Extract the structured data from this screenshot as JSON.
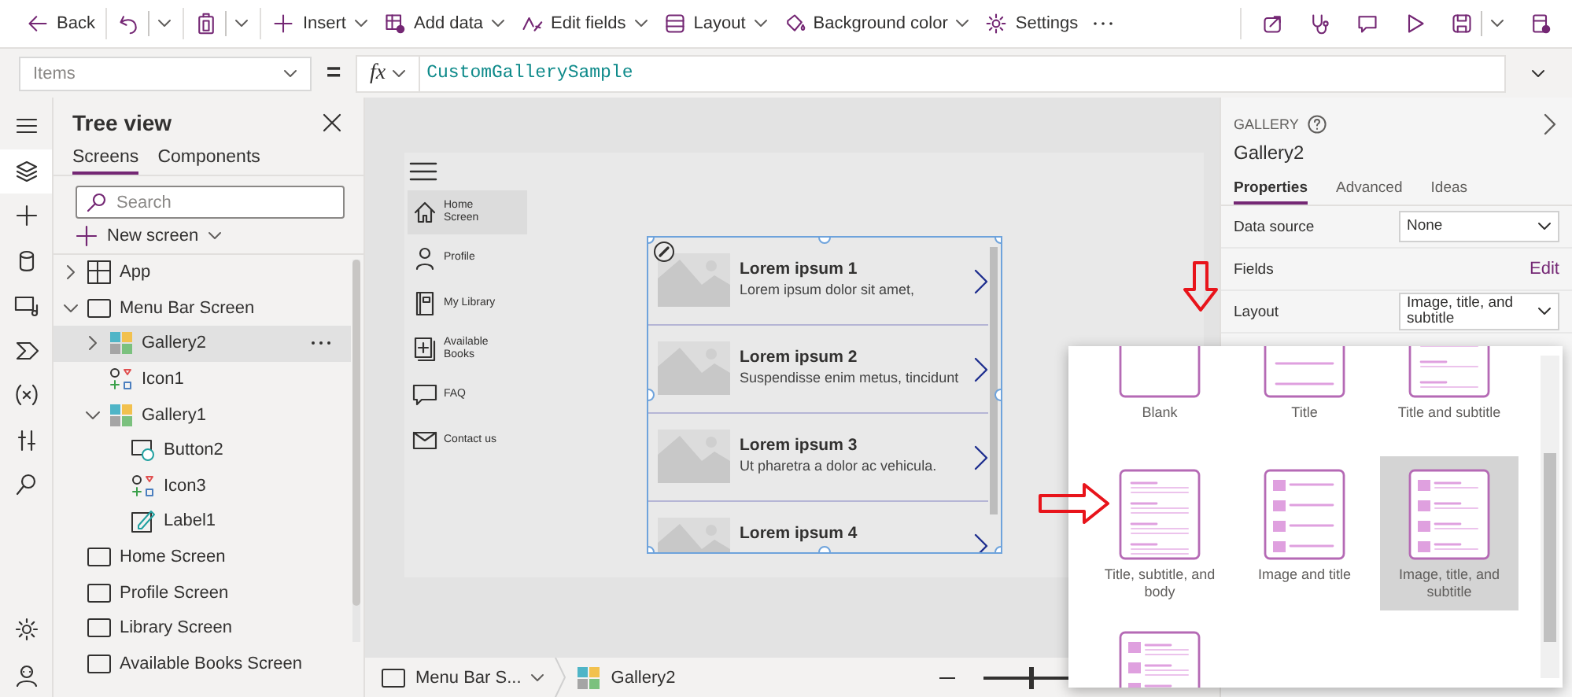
{
  "toolbar": {
    "items": [
      {
        "kind": "back",
        "label": "Back",
        "dropdown": false
      },
      {
        "kind": "undo",
        "dropdown": true
      },
      {
        "kind": "paste",
        "dropdown": true
      },
      {
        "kind": "insert",
        "label": "Insert",
        "dropdown": true
      },
      {
        "kind": "add-data",
        "label": "Add data",
        "dropdown": true
      },
      {
        "kind": "edit-fields",
        "label": "Edit fields",
        "dropdown": true
      },
      {
        "kind": "layout",
        "label": "Layout",
        "dropdown": true
      },
      {
        "kind": "background",
        "label": "Background color",
        "dropdown": true
      },
      {
        "kind": "settings",
        "label": "Settings",
        "dropdown": false
      },
      {
        "kind": "more",
        "dropdown": false
      }
    ],
    "actions": [
      {
        "kind": "share",
        "dropdown": false
      },
      {
        "kind": "checker",
        "dropdown": false
      },
      {
        "kind": "comment",
        "dropdown": false
      },
      {
        "kind": "play",
        "dropdown": false
      },
      {
        "kind": "save",
        "dropdown": true
      },
      {
        "kind": "publish",
        "dropdown": false
      }
    ]
  },
  "formula_bar": {
    "property": "Items",
    "operator": "=",
    "fx": "fx",
    "formula": "CustomGallerySample"
  },
  "left_rail": {
    "items": [
      {
        "kind": "menu",
        "selected": false
      },
      {
        "kind": "tree",
        "selected": true
      },
      {
        "kind": "insert",
        "selected": false
      },
      {
        "kind": "data",
        "selected": false
      },
      {
        "kind": "media",
        "selected": false
      },
      {
        "kind": "flow",
        "selected": false
      },
      {
        "kind": "variables",
        "selected": false
      },
      {
        "kind": "tools",
        "selected": false
      },
      {
        "kind": "search",
        "selected": false
      }
    ],
    "bottom_items": [
      {
        "kind": "settings",
        "selected": false
      },
      {
        "kind": "agent",
        "selected": false
      }
    ]
  },
  "tree_view": {
    "title": "Tree view",
    "tabs": [
      {
        "label": "Screens",
        "selected": true
      },
      {
        "label": "Components",
        "selected": false
      }
    ],
    "search": {
      "placeholder": "Search"
    },
    "new_screen": "New screen",
    "items": [
      {
        "kind": "app",
        "label": "App",
        "expanded": false,
        "selected": false
      },
      {
        "kind": "screen",
        "label": "Menu Bar Screen",
        "expanded": true,
        "selected": false,
        "children": [
          {
            "kind": "gallery",
            "label": "Gallery2",
            "expanded": false,
            "selected": true
          },
          {
            "kind": "icon",
            "label": "Icon1",
            "selected": false
          },
          {
            "kind": "gallery",
            "label": "Gallery1",
            "expanded": true,
            "selected": false,
            "children": [
              {
                "kind": "button",
                "label": "Button2",
                "selected": false
              },
              {
                "kind": "icon",
                "label": "Icon3",
                "selected": false
              },
              {
                "kind": "label",
                "label": "Label1",
                "selected": false
              }
            ]
          }
        ]
      },
      {
        "kind": "screen",
        "label": "Home Screen",
        "selected": false
      },
      {
        "kind": "screen",
        "label": "Profile Screen",
        "selected": false
      },
      {
        "kind": "screen",
        "label": "Library Screen",
        "selected": false
      },
      {
        "kind": "screen",
        "label": "Available Books Screen",
        "selected": false
      }
    ]
  },
  "canvas": {
    "app_screen": {
      "nav_items": [
        {
          "kind": "home",
          "label": "Home Screen",
          "selected": true
        },
        {
          "kind": "person",
          "label": "Profile",
          "selected": false
        },
        {
          "kind": "book",
          "label": "My Library",
          "selected": false
        },
        {
          "kind": "add-book",
          "label": "Available Books",
          "selected": false
        },
        {
          "kind": "chat",
          "label": "FAQ",
          "selected": false
        },
        {
          "kind": "mail",
          "label": "Contact us",
          "selected": false
        }
      ],
      "gallery": {
        "items": [
          {
            "title": "Lorem ipsum 1",
            "subtitle": "Lorem ipsum dolor sit amet,"
          },
          {
            "title": "Lorem ipsum 2",
            "subtitle": "Suspendisse enim metus, tincidunt"
          },
          {
            "title": "Lorem ipsum 3",
            "subtitle": "Ut pharetra a dolor ac vehicula."
          },
          {
            "title": "Lorem ipsum 4"
          }
        ]
      }
    },
    "bottom_bar": {
      "breadcrumbs": [
        {
          "kind": "screen",
          "label": "Menu Bar S...",
          "dropdown": true
        },
        {
          "kind": "gallery",
          "label": "Gallery2",
          "dropdown": false
        }
      ],
      "zoom": {
        "level": 0.2
      }
    }
  },
  "properties_panel": {
    "type": "GALLERY",
    "name": "Gallery2",
    "tabs": [
      {
        "label": "Properties",
        "selected": true
      },
      {
        "label": "Advanced",
        "selected": false
      },
      {
        "label": "Ideas",
        "selected": false
      }
    ],
    "rows": [
      {
        "kind": "dropdown",
        "label": "Data source",
        "value": "None"
      },
      {
        "kind": "link",
        "label": "Fields",
        "value": "Edit"
      },
      {
        "kind": "dropdown",
        "label": "Layout",
        "value": "Image, title, and subtitle"
      }
    ]
  },
  "layout_picker": {
    "options": [
      {
        "kind": "blank",
        "label": "Blank",
        "selected": false
      },
      {
        "kind": "title",
        "label": "Title",
        "selected": false
      },
      {
        "kind": "title-subtitle",
        "label": "Title and subtitle",
        "selected": false
      },
      {
        "kind": "title-subtitle-body",
        "label": "Title, subtitle, and body",
        "selected": false
      },
      {
        "kind": "image-title",
        "label": "Image and title",
        "selected": false
      },
      {
        "kind": "image-title-subtitle",
        "label": "Image, title, and subtitle",
        "selected": true
      },
      {
        "kind": "image-title-subtitle-body",
        "selected": false
      }
    ]
  },
  "annotations": [
    {
      "kind": "arrow-down"
    },
    {
      "kind": "arrow-right"
    }
  ]
}
